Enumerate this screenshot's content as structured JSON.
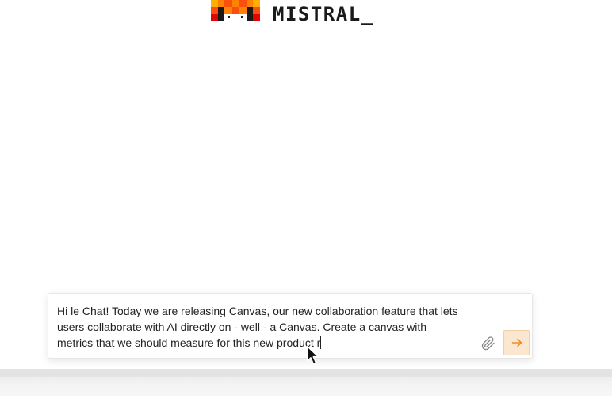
{
  "brand": {
    "logo_icon": "mistral-pixel-logo",
    "wordmark": "MISTRAL_",
    "colors": [
      "#e10500",
      "#fa500f",
      "#ff8205",
      "#ffaf00",
      "#ffd800",
      "#1a1a1a"
    ]
  },
  "composer": {
    "text": "Hi le Chat! Today we are releasing Canvas, our new collaboration feature that lets users collaborate with AI directly on - well - a Canvas. Create a canvas with metrics that we should measure for this new product r",
    "attach_icon": "paperclip-icon",
    "send_icon": "arrow-right-icon",
    "send_color": "#fbe6d0",
    "send_arrow_color": "#f08a24"
  },
  "cursor_icon": "mouse-pointer-icon"
}
